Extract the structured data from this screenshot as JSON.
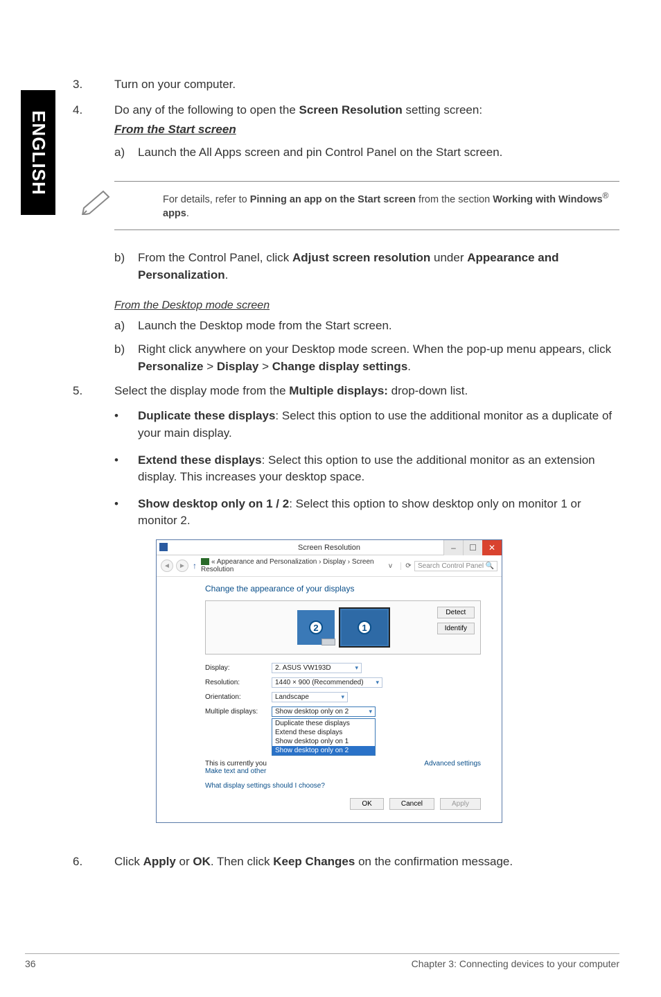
{
  "side_label": "ENGLISH",
  "steps": {
    "s3": {
      "num": "3.",
      "text": "Turn on your computer."
    },
    "s4": {
      "num": "4.",
      "intro_a": "Do any of the following to open the ",
      "intro_b": "Screen Resolution",
      "intro_c": " setting screen:",
      "h1": "From the Start screen",
      "a": {
        "lab": "a)",
        "text": "Launch the All Apps screen and pin Control Panel on the Start screen."
      },
      "note_a": "For details, refer to ",
      "note_b": "Pinning an app on the Start screen",
      "note_c": " from the section ",
      "note_d": "Working with Windows",
      "note_e": "®",
      "note_f": " apps",
      "note_g": ".",
      "b": {
        "lab": "b)",
        "t1": "From the Control Panel, click ",
        "t2": "Adjust screen resolution",
        "t3": " under ",
        "t4": "Appearance and Personalization",
        "t5": "."
      },
      "h2": "From the Desktop mode screen",
      "d_a": {
        "lab": "a)",
        "text": "Launch the Desktop mode from the Start screen."
      },
      "d_b": {
        "lab": "b)",
        "t1": "Right click anywhere on your Desktop mode screen. When the pop-up menu appears, click ",
        "t2": "Personalize",
        "t3": " > ",
        "t4": "Display",
        "t5": " > ",
        "t6": "Change display settings",
        "t7": "."
      }
    },
    "s5": {
      "num": "5.",
      "t1": "Select the display mode from the ",
      "t2": "Multiple displays:",
      "t3": " drop-down list.",
      "b1": {
        "h": "Duplicate these displays",
        "t": ": Select this option to use the additional monitor as a duplicate of your main display."
      },
      "b2": {
        "h": "Extend these displays",
        "t": ": Select this option to use the additional monitor as an extension display. This increases your desktop space."
      },
      "b3": {
        "h": "Show desktop only on 1 / 2",
        "t": ": Select this option to show desktop only on monitor 1 or monitor 2."
      }
    },
    "s6": {
      "num": "6.",
      "t1": "Click ",
      "t2": "Apply",
      "t3": " or ",
      "t4": "OK",
      "t5": ". Then click ",
      "t6": "Keep Changes",
      "t7": " on the confirmation message."
    }
  },
  "win": {
    "title": "Screen Resolution",
    "breadcrumb": "« Appearance and Personalization › Display › Screen Resolution",
    "search_placeholder": "Search Control Panel",
    "heading": "Change the appearance of your displays",
    "detect": "Detect",
    "identify": "Identify",
    "rows": {
      "display": {
        "label": "Display:",
        "value": "2. ASUS VW193D"
      },
      "resolution": {
        "label": "Resolution:",
        "value": "1440 × 900 (Recommended)"
      },
      "orientation": {
        "label": "Orientation:",
        "value": "Landscape"
      },
      "multiple": {
        "label": "Multiple displays:",
        "value": "Show desktop only on 2"
      }
    },
    "dropdown": {
      "o1": "Duplicate these displays",
      "o2": "Extend these displays",
      "o3": "Show desktop only on 1",
      "o4": "Show desktop only on 2"
    },
    "adv_left_a": "This is currently you",
    "adv_left_b": "Make text and other",
    "adv_right": "Advanced settings",
    "help": "What display settings should I choose?",
    "ok": "OK",
    "cancel": "Cancel",
    "apply": "Apply"
  },
  "footer": {
    "page": "36",
    "chapter": "Chapter 3:  Connecting devices to your computer"
  }
}
